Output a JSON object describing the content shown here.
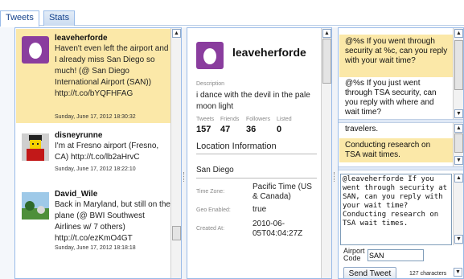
{
  "tabs": [
    {
      "label": "Tweets",
      "active": true
    },
    {
      "label": "Stats",
      "active": false
    }
  ],
  "tweets": [
    {
      "user": "leaveherforde",
      "text": "Haven't even left the airport and I already miss San Diego so much! (@ San Diego International Airport (SAN)) http://t.co/bYQFHFAG",
      "date": "Sunday, June 17, 2012 18:30:32",
      "selected": true,
      "avatar_icon": "egg-avatar-icon"
    },
    {
      "user": "disneyrunne",
      "text": "I'm at Fresno airport (Fresno, CA) http://t.co/lb2aHrvC",
      "date": "Sunday, June 17, 2012 18:22:10",
      "selected": false,
      "avatar_icon": "lego-figure-avatar-icon"
    },
    {
      "user": "David_Wile",
      "text": "Back in Maryland, but still on the plane (@ BWI Southwest Airlines w/ 7 others) http://t.co/ezKmO4GT",
      "date": "Sunday, June 17, 2012 18:18:18",
      "selected": false,
      "avatar_icon": "landscape-photo-avatar-icon"
    }
  ],
  "profile": {
    "name": "leaveherforde",
    "description_label": "Description",
    "description": "i dance with the devil in the pale moon light",
    "stats": [
      {
        "label": "Tweets",
        "value": "157"
      },
      {
        "label": "Friends",
        "value": "47"
      },
      {
        "label": "Followers",
        "value": "36"
      },
      {
        "label": "Listed",
        "value": "0"
      }
    ],
    "location_header": "Location Information",
    "location": "San Diego",
    "time_zone_label": "Time Zone:",
    "time_zone": "Pacific Time (US & Canada)",
    "geo_label": "Geo Enabled:",
    "geo": "true",
    "created_label": "Created At:",
    "created": "2010-06-05T04:04:27Z"
  },
  "templates": [
    {
      "text": "@%s If you went through security at %c, can you reply with your wait time?",
      "highlighted": true
    },
    {
      "text": "@%s If you just went through TSA security, can you reply with where and wait time?",
      "highlighted": false
    }
  ],
  "endings": [
    {
      "text": "travelers.",
      "highlighted": false
    },
    {
      "text": "Conducting research on TSA wait times.",
      "highlighted": true
    }
  ],
  "compose": {
    "text": "@leaveherforde If you went through security at SAN, can you reply with your wait time? Conducting research on TSA wait times.",
    "airport_label": "Airport Code",
    "airport_code": "SAN",
    "send_label": "Send Tweet",
    "char_count": "127 characters"
  },
  "colors": {
    "highlight": "#fbe8a8",
    "border": "#99bbe8",
    "tab_text": "#15428b"
  }
}
